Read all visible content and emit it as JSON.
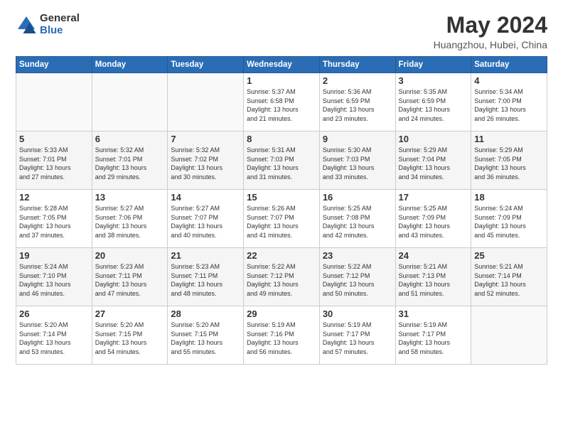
{
  "header": {
    "logo_general": "General",
    "logo_blue": "Blue",
    "title": "May 2024",
    "subtitle": "Huangzhou, Hubei, China"
  },
  "days_of_week": [
    "Sunday",
    "Monday",
    "Tuesday",
    "Wednesday",
    "Thursday",
    "Friday",
    "Saturday"
  ],
  "weeks": [
    [
      {
        "day": "",
        "info": ""
      },
      {
        "day": "",
        "info": ""
      },
      {
        "day": "",
        "info": ""
      },
      {
        "day": "1",
        "info": "Sunrise: 5:37 AM\nSunset: 6:58 PM\nDaylight: 13 hours\nand 21 minutes."
      },
      {
        "day": "2",
        "info": "Sunrise: 5:36 AM\nSunset: 6:59 PM\nDaylight: 13 hours\nand 23 minutes."
      },
      {
        "day": "3",
        "info": "Sunrise: 5:35 AM\nSunset: 6:59 PM\nDaylight: 13 hours\nand 24 minutes."
      },
      {
        "day": "4",
        "info": "Sunrise: 5:34 AM\nSunset: 7:00 PM\nDaylight: 13 hours\nand 26 minutes."
      }
    ],
    [
      {
        "day": "5",
        "info": "Sunrise: 5:33 AM\nSunset: 7:01 PM\nDaylight: 13 hours\nand 27 minutes."
      },
      {
        "day": "6",
        "info": "Sunrise: 5:32 AM\nSunset: 7:01 PM\nDaylight: 13 hours\nand 29 minutes."
      },
      {
        "day": "7",
        "info": "Sunrise: 5:32 AM\nSunset: 7:02 PM\nDaylight: 13 hours\nand 30 minutes."
      },
      {
        "day": "8",
        "info": "Sunrise: 5:31 AM\nSunset: 7:03 PM\nDaylight: 13 hours\nand 31 minutes."
      },
      {
        "day": "9",
        "info": "Sunrise: 5:30 AM\nSunset: 7:03 PM\nDaylight: 13 hours\nand 33 minutes."
      },
      {
        "day": "10",
        "info": "Sunrise: 5:29 AM\nSunset: 7:04 PM\nDaylight: 13 hours\nand 34 minutes."
      },
      {
        "day": "11",
        "info": "Sunrise: 5:29 AM\nSunset: 7:05 PM\nDaylight: 13 hours\nand 36 minutes."
      }
    ],
    [
      {
        "day": "12",
        "info": "Sunrise: 5:28 AM\nSunset: 7:05 PM\nDaylight: 13 hours\nand 37 minutes."
      },
      {
        "day": "13",
        "info": "Sunrise: 5:27 AM\nSunset: 7:06 PM\nDaylight: 13 hours\nand 38 minutes."
      },
      {
        "day": "14",
        "info": "Sunrise: 5:27 AM\nSunset: 7:07 PM\nDaylight: 13 hours\nand 40 minutes."
      },
      {
        "day": "15",
        "info": "Sunrise: 5:26 AM\nSunset: 7:07 PM\nDaylight: 13 hours\nand 41 minutes."
      },
      {
        "day": "16",
        "info": "Sunrise: 5:25 AM\nSunset: 7:08 PM\nDaylight: 13 hours\nand 42 minutes."
      },
      {
        "day": "17",
        "info": "Sunrise: 5:25 AM\nSunset: 7:09 PM\nDaylight: 13 hours\nand 43 minutes."
      },
      {
        "day": "18",
        "info": "Sunrise: 5:24 AM\nSunset: 7:09 PM\nDaylight: 13 hours\nand 45 minutes."
      }
    ],
    [
      {
        "day": "19",
        "info": "Sunrise: 5:24 AM\nSunset: 7:10 PM\nDaylight: 13 hours\nand 46 minutes."
      },
      {
        "day": "20",
        "info": "Sunrise: 5:23 AM\nSunset: 7:11 PM\nDaylight: 13 hours\nand 47 minutes."
      },
      {
        "day": "21",
        "info": "Sunrise: 5:23 AM\nSunset: 7:11 PM\nDaylight: 13 hours\nand 48 minutes."
      },
      {
        "day": "22",
        "info": "Sunrise: 5:22 AM\nSunset: 7:12 PM\nDaylight: 13 hours\nand 49 minutes."
      },
      {
        "day": "23",
        "info": "Sunrise: 5:22 AM\nSunset: 7:12 PM\nDaylight: 13 hours\nand 50 minutes."
      },
      {
        "day": "24",
        "info": "Sunrise: 5:21 AM\nSunset: 7:13 PM\nDaylight: 13 hours\nand 51 minutes."
      },
      {
        "day": "25",
        "info": "Sunrise: 5:21 AM\nSunset: 7:14 PM\nDaylight: 13 hours\nand 52 minutes."
      }
    ],
    [
      {
        "day": "26",
        "info": "Sunrise: 5:20 AM\nSunset: 7:14 PM\nDaylight: 13 hours\nand 53 minutes."
      },
      {
        "day": "27",
        "info": "Sunrise: 5:20 AM\nSunset: 7:15 PM\nDaylight: 13 hours\nand 54 minutes."
      },
      {
        "day": "28",
        "info": "Sunrise: 5:20 AM\nSunset: 7:15 PM\nDaylight: 13 hours\nand 55 minutes."
      },
      {
        "day": "29",
        "info": "Sunrise: 5:19 AM\nSunset: 7:16 PM\nDaylight: 13 hours\nand 56 minutes."
      },
      {
        "day": "30",
        "info": "Sunrise: 5:19 AM\nSunset: 7:17 PM\nDaylight: 13 hours\nand 57 minutes."
      },
      {
        "day": "31",
        "info": "Sunrise: 5:19 AM\nSunset: 7:17 PM\nDaylight: 13 hours\nand 58 minutes."
      },
      {
        "day": "",
        "info": ""
      }
    ]
  ]
}
